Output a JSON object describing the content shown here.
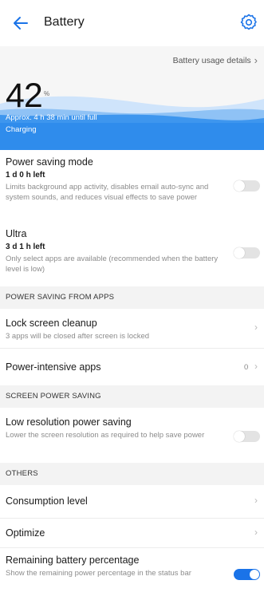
{
  "header": {
    "title": "Battery",
    "back_icon": "back-arrow-icon",
    "settings_icon": "gear-icon",
    "accent": "#1a73e8"
  },
  "battery": {
    "usage_link": "Battery usage details",
    "percent": "42",
    "percent_sign": "%",
    "estimate": "Approx. 4 h 38 min until full",
    "status": "Charging"
  },
  "power_saving": {
    "title": "Power saving mode",
    "time_left": "1 d 0 h left",
    "description": "Limits background app activity, disables email auto-sync and system sounds, and reduces visual effects to save power",
    "enabled": false
  },
  "ultra": {
    "title": "Ultra",
    "time_left": "3 d 1 h left",
    "description": "Only select apps are available (recommended when the battery level is low)",
    "enabled": false
  },
  "section_apps": {
    "label": "POWER SAVING FROM APPS",
    "lock_screen": {
      "title": "Lock screen cleanup",
      "description": "3 apps will be closed after screen is locked"
    },
    "power_intensive": {
      "title": "Power-intensive apps",
      "count": "0"
    }
  },
  "section_screen": {
    "label": "SCREEN POWER SAVING",
    "low_res": {
      "title": "Low resolution power saving",
      "description": "Lower the screen resolution as required to help save power",
      "enabled": false
    }
  },
  "section_others": {
    "label": "OTHERS",
    "consumption": {
      "title": "Consumption level"
    },
    "optimize": {
      "title": "Optimize"
    },
    "remaining_pct": {
      "title": "Remaining battery percentage",
      "description": "Show the remaining power percentage in the status bar",
      "enabled": true
    }
  }
}
